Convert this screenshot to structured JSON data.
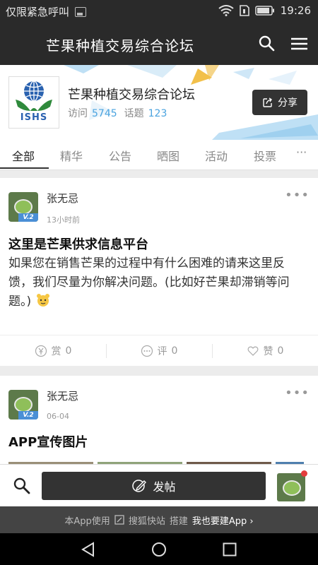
{
  "status_bar": {
    "emergency": "仅限紧急呼叫",
    "time": "19:26"
  },
  "app_bar": {
    "title": "芒果种植交易综合论坛",
    "search_icon": "search-icon",
    "menu_icon": "menu-icon"
  },
  "forum": {
    "logo_text": "ISHS",
    "name": "芒果种植交易综合论坛",
    "visits_label": "访问",
    "visits": "5745",
    "topics_label": "话题",
    "topics": "123",
    "share_label": "分享"
  },
  "tabs": [
    "全部",
    "精华",
    "公告",
    "晒图",
    "活动",
    "投票",
    "···"
  ],
  "posts": [
    {
      "author": "张无忌",
      "time": "13小时前",
      "badge": "V.2",
      "title": "这里是芒果供求信息平台",
      "body": "如果您在销售芒果的过程中有什么困难的请来这里反馈，我们尽量为你解决问题。(比如好芒果却滞销等问题。)",
      "reward_label": "赏",
      "reward": "0",
      "comment_label": "评",
      "comments": "0",
      "like_label": "赞",
      "likes": "0"
    },
    {
      "author": "张无忌",
      "time": "06-04",
      "badge": "V.2",
      "title": "APP宣传图片"
    }
  ],
  "bottom": {
    "post_button": "发帖"
  },
  "footer": {
    "text1": "本App使用",
    "brand": "搜狐快站",
    "text2": "搭建",
    "cta": "我也要建App"
  },
  "colors": {
    "dark": "#2a2a2a",
    "accent": "#4aa3df",
    "badge": "#4a8fd6",
    "notify": "#e43d3d"
  }
}
